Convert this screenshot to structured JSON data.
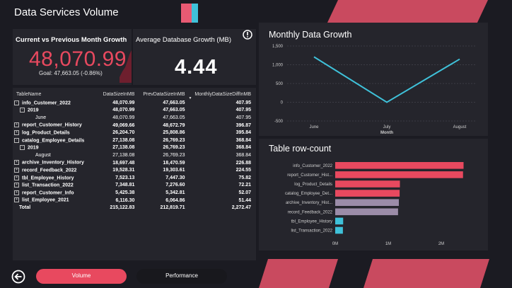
{
  "page": {
    "title": "Data Services Volume"
  },
  "colors": {
    "accent": "#e8495f",
    "cyan": "#3fc1d9",
    "purple": "#9b8ca8",
    "panel": "#25252c",
    "background": "#1b1b22"
  },
  "kpi_growth": {
    "title": "Current vs Previous Month Growth",
    "value": "48,070.99",
    "goal": "Goal: 47,663.05 (-0.86%)"
  },
  "kpi_avg": {
    "title": "Average Database Growth (MB)",
    "value": "4.44",
    "info_icon": "info-icon"
  },
  "matrix": {
    "headers": [
      "TableName",
      "DataSizeInMB",
      "PrevDataSizeInMB",
      "MonthlyDataSizeDiffInMB"
    ],
    "rows": [
      {
        "name": "info_Customer_2022",
        "level": 0,
        "toggle": "-",
        "bold": true,
        "values": [
          "48,070.99",
          "47,663.05",
          "407.95"
        ]
      },
      {
        "name": "2019",
        "level": 1,
        "toggle": "-",
        "bold": true,
        "values": [
          "48,070.99",
          "47,663.05",
          "407.95"
        ]
      },
      {
        "name": "June",
        "level": 2,
        "toggle": "",
        "bold": false,
        "values": [
          "48,070.99",
          "47,663.05",
          "407.95"
        ]
      },
      {
        "name": "report_Customer_History",
        "level": 0,
        "toggle": "+",
        "bold": true,
        "values": [
          "49,069.66",
          "48,672.79",
          "396.87"
        ]
      },
      {
        "name": "log_Product_Details",
        "level": 0,
        "toggle": "+",
        "bold": true,
        "values": [
          "26,204.70",
          "25,808.86",
          "395.84"
        ]
      },
      {
        "name": "catalog_Employee_Details",
        "level": 0,
        "toggle": "-",
        "bold": true,
        "values": [
          "27,138.08",
          "26,769.23",
          "368.84"
        ]
      },
      {
        "name": "2019",
        "level": 1,
        "toggle": "-",
        "bold": true,
        "values": [
          "27,138.08",
          "26,769.23",
          "368.84"
        ]
      },
      {
        "name": "August",
        "level": 2,
        "toggle": "",
        "bold": false,
        "values": [
          "27,138.08",
          "26,769.23",
          "368.84"
        ]
      },
      {
        "name": "archive_Inventory_History",
        "level": 0,
        "toggle": "+",
        "bold": true,
        "values": [
          "18,697.48",
          "18,470.59",
          "226.88"
        ]
      },
      {
        "name": "record_Feedback_2022",
        "level": 0,
        "toggle": "+",
        "bold": true,
        "values": [
          "19,528.31",
          "19,303.61",
          "224.55"
        ]
      },
      {
        "name": "tbl_Employee_History",
        "level": 0,
        "toggle": "+",
        "bold": true,
        "values": [
          "7,523.13",
          "7,447.30",
          "75.82"
        ]
      },
      {
        "name": "list_Transaction_2022",
        "level": 0,
        "toggle": "+",
        "bold": true,
        "values": [
          "7,348.81",
          "7,276.60",
          "72.21"
        ]
      },
      {
        "name": "report_Customer_Info",
        "level": 0,
        "toggle": "+",
        "bold": true,
        "values": [
          "5,425.38",
          "5,342.81",
          "52.07"
        ]
      },
      {
        "name": "list_Employee_2021",
        "level": 0,
        "toggle": "+",
        "bold": true,
        "values": [
          "6,116.30",
          "6,064.86",
          "51.44"
        ]
      }
    ],
    "total": {
      "name": "Total",
      "values": [
        "215,122.83",
        "212,819.71",
        "2,272.47"
      ]
    }
  },
  "chart_data": [
    {
      "type": "line",
      "title": "Monthly Data Growth",
      "xlabel": "Month",
      "ylabel": "",
      "categories": [
        "June",
        "July",
        "August"
      ],
      "series": [
        {
          "values": [
            1210,
            0,
            1150
          ]
        }
      ],
      "yticks": [
        "1,500",
        "1,000",
        "500",
        "0",
        "-500"
      ],
      "ylim": [
        -500,
        1500
      ],
      "grid": true
    },
    {
      "type": "bar",
      "orientation": "horizontal",
      "title": "Table row-count",
      "categories": [
        "info_Customer_2022",
        "report_Customer_Hist...",
        "log_Product_Details",
        "catalog_Employee_Det...",
        "archive_Inventory_Hist...",
        "record_Feedback_2022",
        "tbl_Employee_History",
        "list_Transaction_2022"
      ],
      "values": [
        2420000,
        2410000,
        1220000,
        1215000,
        1200000,
        1185000,
        150000,
        145000
      ],
      "bar_colors": [
        "#e8495f",
        "#e8495f",
        "#e8495f",
        "#e8495f",
        "#9b8ca8",
        "#9b8ca8",
        "#3fc1d9",
        "#3fc1d9"
      ],
      "xticks": [
        "0M",
        "1M",
        "2M"
      ],
      "xlim": [
        0,
        2800000
      ]
    }
  ],
  "nav": {
    "back_icon": "back-arrow-icon",
    "buttons": [
      {
        "label": "Volume",
        "active": true
      },
      {
        "label": "Performance",
        "active": false
      }
    ]
  }
}
